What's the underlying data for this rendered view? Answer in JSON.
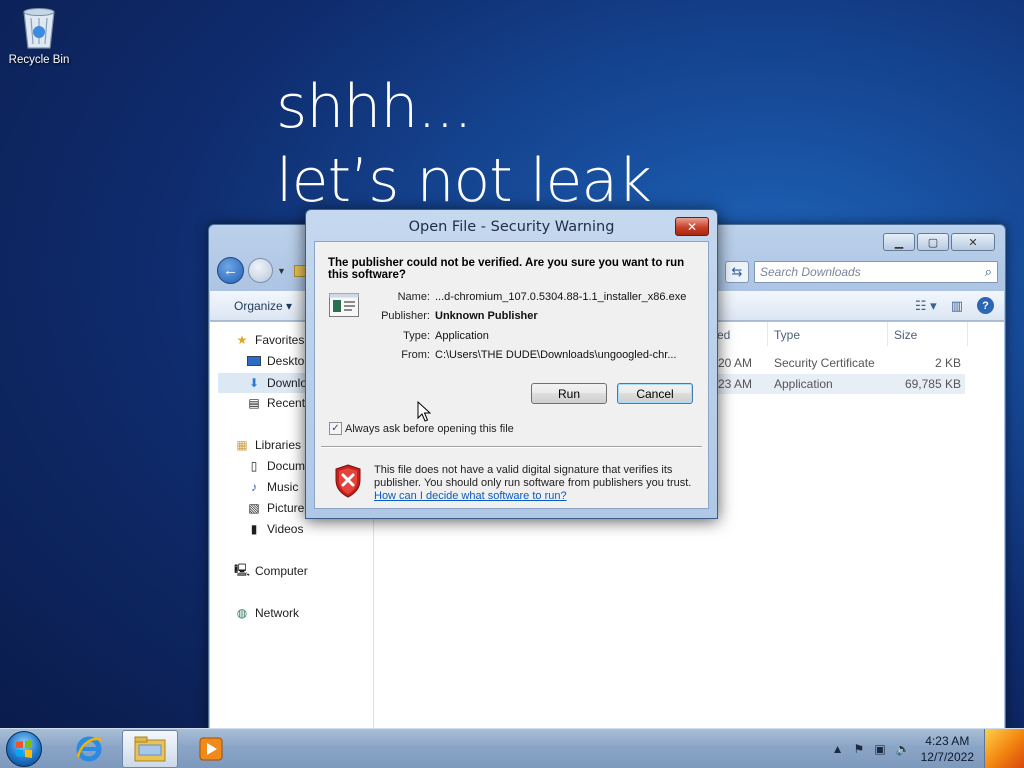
{
  "desktop": {
    "recycle_bin_label": "Recycle Bin",
    "wallpaper_line1": "shhh...",
    "wallpaper_line2": "let’s not leak"
  },
  "explorer": {
    "search_placeholder": "Search Downloads",
    "organize_label": "Organize",
    "nav": {
      "favorites": "Favorites",
      "desktop": "Desktop",
      "downloads": "Downlo",
      "recent": "Recent",
      "libraries": "Libraries",
      "documents": "Docum",
      "music": "Music",
      "pictures": "Picture",
      "videos": "Videos",
      "computer": "Computer",
      "network": "Network"
    },
    "columns": {
      "date_partial": "ed",
      "type": "Type",
      "size": "Size"
    },
    "files": [
      {
        "time": "20 AM",
        "type": "Security Certificate",
        "size": "2 KB"
      },
      {
        "time": "23 AM",
        "type": "Application",
        "size": "69,785 KB"
      }
    ]
  },
  "dialog": {
    "title": "Open File - Security Warning",
    "question": "The publisher could not be verified.  Are you sure you want to run this software?",
    "fields": {
      "name_label": "Name:",
      "name_value": "...d-chromium_107.0.5304.88-1.1_installer_x86.exe",
      "publisher_label": "Publisher:",
      "publisher_value": "Unknown Publisher",
      "type_label": "Type:",
      "type_value": "Application",
      "from_label": "From:",
      "from_value": "C:\\Users\\THE DUDE\\Downloads\\ungoogled-chr..."
    },
    "run_label": "Run",
    "cancel_label": "Cancel",
    "always_ask_label": "Always ask before opening this file",
    "always_ask_checked": true,
    "warning_text": "This file does not have a valid digital signature that verifies its publisher.  You should only run software from publishers you trust.",
    "help_link": "How can I decide what software to run?"
  },
  "taskbar": {
    "time": "4:23 AM",
    "date": "12/7/2022"
  }
}
